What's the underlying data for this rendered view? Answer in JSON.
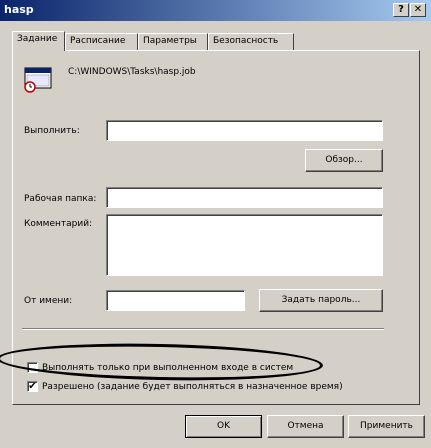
{
  "window": {
    "title": "hasp",
    "help_glyph": "?",
    "close_glyph": "✕"
  },
  "tabs": [
    "Задание",
    "Расписание",
    "Параметры",
    "Безопасность"
  ],
  "task": {
    "path": "C:\\WINDOWS\\Tasks\\hasp.job"
  },
  "form": {
    "run_label": "Выполнить:",
    "run_value": "",
    "browse_label": "Обзор...",
    "workdir_label": "Рабочая папка:",
    "workdir_value": "",
    "comment_label": "Комментарий:",
    "comment_value": "",
    "runas_label": "От имени:",
    "runas_value": "",
    "set_password_label": "Задать пароль..."
  },
  "options": {
    "logon_only_label": "Выполнять только при выполненном входе в систем",
    "logon_only_checked": false,
    "enabled_label": "Разрешено (задание будет выполняться в назначенное время)",
    "enabled_checked": true
  },
  "buttons": {
    "ok": "OK",
    "cancel": "Отмена",
    "apply": "Применить"
  }
}
